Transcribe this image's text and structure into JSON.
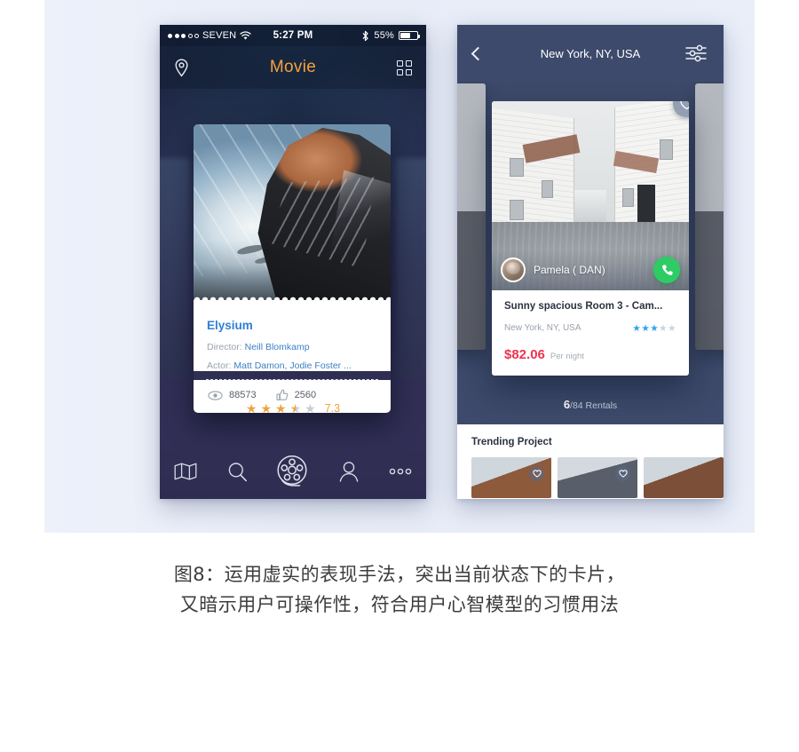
{
  "caption": {
    "line1": "图8：运用虚实的表现手法，突出当前状态下的卡片，",
    "line2": "又暗示用户可操作性，符合用户心智模型的习惯用法"
  },
  "movie_phone": {
    "status_bar": {
      "carrier": "SEVEN",
      "signal_dots_filled": 3,
      "signal_dots_total": 5,
      "wifi_icon": "wifi-icon",
      "time": "5:27 PM",
      "bluetooth_icon": "bluetooth-icon",
      "battery_percent": "55%"
    },
    "navbar": {
      "location_icon": "location-pin-icon",
      "title": "Movie",
      "title_color": "#f4a23c",
      "grid_icon": "grid-icon"
    },
    "card": {
      "poster_alt": "Elysium movie poster",
      "title": "Elysium",
      "title_color": "#2f7fd4",
      "director_label": "Director:",
      "director_value": "Neill Blomkamp",
      "actor_label": "Actor:",
      "actor_value": "Matt Damon, Jodie Foster ...",
      "views_icon": "eye-icon",
      "views_count": "88573",
      "likes_icon": "thumbs-up-icon",
      "likes_count": "2560"
    },
    "rating": {
      "stars_filled": 3,
      "stars_half": 1,
      "stars_total": 5,
      "score": "7.3",
      "star_color": "#f0a23a"
    },
    "tabbar": [
      {
        "name": "map-icon",
        "label": "Map"
      },
      {
        "name": "search-icon",
        "label": "Search"
      },
      {
        "name": "film-reel-icon",
        "label": "Movies"
      },
      {
        "name": "person-icon",
        "label": "Profile"
      },
      {
        "name": "more-icon",
        "label": "More"
      }
    ]
  },
  "rental_phone": {
    "header": {
      "back_icon": "back-chevron-icon",
      "title": "New York, NY, USA",
      "filter_icon": "filter-sliders-icon"
    },
    "listing": {
      "photo_alt": "White wooden houses on a cobbled street",
      "favorite_icon": "heart-icon",
      "host_name": "Pamela ( DAN)",
      "host_avatar": "avatar",
      "call_icon": "phone-call-icon",
      "call_button_color": "#2ecc64",
      "title": "Sunny spacious Room 3 - Cam...",
      "location": "New York, NY, USA",
      "stars_filled": 3,
      "stars_total": 5,
      "star_color": "#2fa3e8",
      "price": "$82.06",
      "price_color": "#f0324f",
      "price_unit": "Per night"
    },
    "pager": {
      "current": "6",
      "rest": "/84 Rentals"
    },
    "trending": {
      "heading": "Trending Project",
      "items": [
        {
          "alt": "Brick house with gabled roof",
          "favorite_icon": "heart-icon"
        },
        {
          "alt": "Grey roofed suburban house",
          "favorite_icon": "heart-icon"
        },
        {
          "alt": "Brown brick building",
          "favorite_icon": "heart-icon"
        }
      ]
    }
  }
}
